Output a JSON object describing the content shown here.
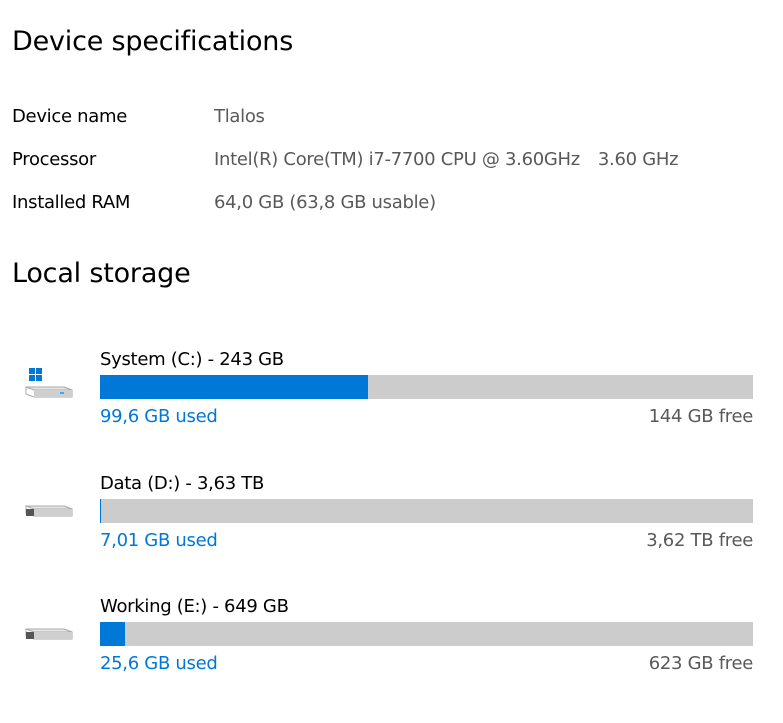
{
  "device_specifications": {
    "title": "Device specifications",
    "rows": [
      {
        "label": "Device name",
        "value": "Tlalos"
      },
      {
        "label": "Processor",
        "value": "Intel(R) Core(TM) i7-7700 CPU @ 3.60GHz",
        "value_extra": "3.60 GHz"
      },
      {
        "label": "Installed RAM",
        "value": "64,0 GB (63,8 GB usable)"
      }
    ]
  },
  "local_storage": {
    "title": "Local storage",
    "drives": [
      {
        "name": "System (C:) - 243 GB",
        "used": "99,6 GB used",
        "free": "144 GB free",
        "used_fraction": 0.41,
        "icon": "windows-drive-icon"
      },
      {
        "name": "Data (D:) - 3,63 TB",
        "used": "7,01 GB used",
        "free": "3,62 TB free",
        "used_fraction": 0.002,
        "icon": "hard-drive-icon"
      },
      {
        "name": "Working (E:) - 649 GB",
        "used": "25,6 GB used",
        "free": "623 GB free",
        "used_fraction": 0.039,
        "icon": "hard-drive-icon"
      }
    ]
  },
  "colors": {
    "accent": "#0078d7",
    "bar_track": "#cccccc",
    "secondary_text": "#595959"
  }
}
